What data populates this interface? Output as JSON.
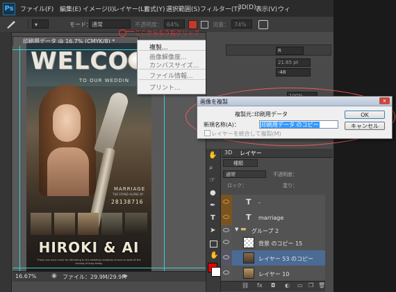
{
  "app": {
    "logo": "Ps"
  },
  "menu": [
    "ファイル(F)",
    "編集(E)",
    "イメージ(I)",
    "レイヤー(L)",
    "書式(Y)",
    "選択範囲(S)",
    "フィルター(T)",
    "3D(D)",
    "表示(V)",
    "ウィ"
  ],
  "options": {
    "mode_label": "モード：",
    "mode_value": "通常",
    "opacity_label": "不透明度：",
    "opacity_value": "64%",
    "flow_label": "流量：",
    "flow_value": "74%"
  },
  "document": {
    "tab_title": "印刷用データ @ 16.7% (CMYK/8) *",
    "zoom": "16.67%",
    "file_size": "ファイル：29.9M/29.9M"
  },
  "poster": {
    "headline": "WELCO",
    "tagline": "TO OUR WEDDIN",
    "marriage": "MARRIAGE",
    "small_line": "THE STAND ALONG BY",
    "date": "28138716",
    "names": "HIROKI & AI",
    "footer": "Thank you very much for attending to the wedding reception of ours in spite of the coming of busy today."
  },
  "annotation": {
    "text": "ここからもう右クリック"
  },
  "context_menu": {
    "items": [
      "複製...",
      "画像解像度...",
      "カンバスサイズ...",
      "ファイル情報...",
      "プリント..."
    ]
  },
  "dialog": {
    "title": "画像を複製",
    "source_label": "複製元：",
    "source_value": "印刷用データ",
    "name_label": "新規名称(A)：",
    "name_value": "印刷用データ のコピー",
    "merge_label": "レイヤーを統合して複製(M)",
    "ok": "OK",
    "cancel": "キャンセル",
    "close": "x"
  },
  "right_panel": {
    "char_unit": "pt",
    "char_size": "21.65 pt",
    "char_value": "-48",
    "char_pct": "100%",
    "font_dropdown": "R"
  },
  "layers_panel": {
    "tabs": [
      "3D",
      "レイヤー"
    ],
    "kind": "種類",
    "blend": "通常",
    "opacity_label": "不透明度：",
    "fill_label": "塗り：",
    "lock_label": "ロック：",
    "layers": [
      {
        "name": "-",
        "type": "text"
      },
      {
        "name": "marriage",
        "type": "text"
      },
      {
        "name": "グループ 2",
        "type": "group"
      },
      {
        "name": "背景 のコピー 15",
        "type": "image"
      },
      {
        "name": "レイヤー 53 のコピー",
        "type": "image"
      },
      {
        "name": "レイヤー 10",
        "type": "image"
      }
    ]
  },
  "colors": {
    "foreground": "#e60000",
    "background": "#ffffff",
    "highlight": "#3399ff",
    "annotation": "#ff2b2b"
  }
}
